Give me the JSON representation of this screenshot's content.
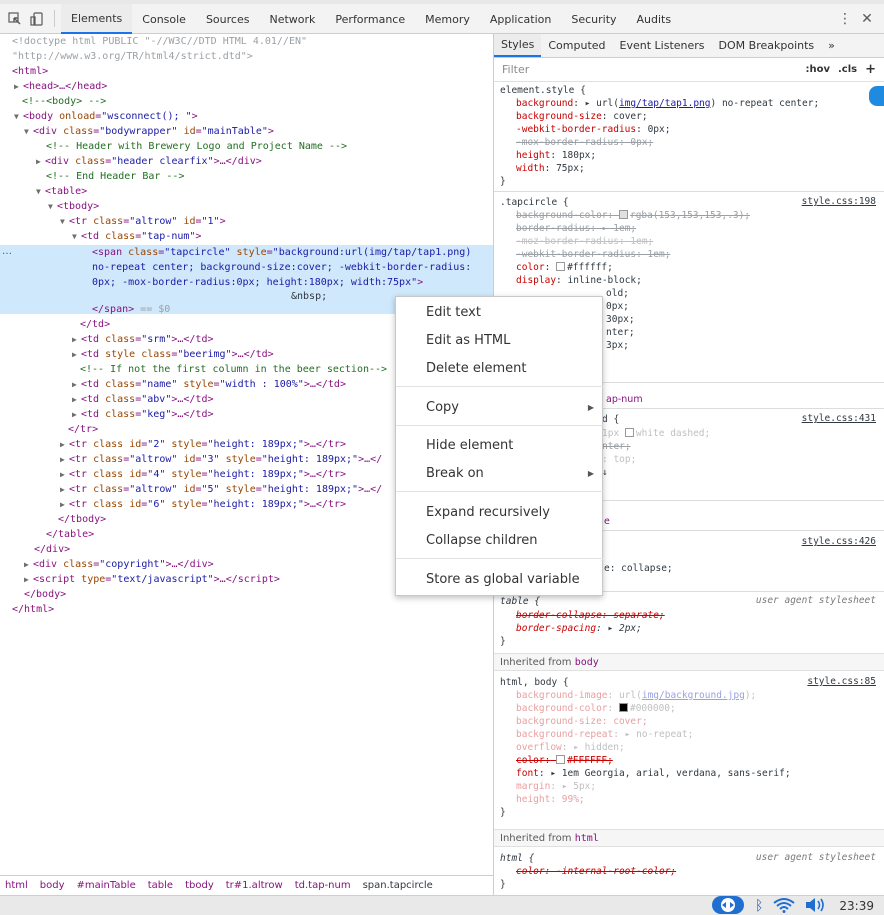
{
  "toolbar": {
    "tabs": [
      "Elements",
      "Console",
      "Sources",
      "Network",
      "Performance",
      "Memory",
      "Application",
      "Security",
      "Audits"
    ],
    "active_tab": "Elements",
    "menu_glyph": "⋮",
    "close_glyph": "✕"
  },
  "dom": {
    "l1a": "<!doctype html PUBLIC \"-//W3C//DTD HTML 4.01//EN\"",
    "l1b": "\"http://www.w3.org/TR/html4/strict.dtd\">",
    "html_open": "<html>",
    "head": "<head>…</head>",
    "body_comment": "<!--<body> -->",
    "body_tag": "<body ",
    "body_attr": "onload",
    "body_val": "\"wsconnect(); \"",
    "div_attr1": "class",
    "div_val1": "\"bodywrapper\"",
    "div_attr2": "id",
    "div_val2": "\"mainTable\"",
    "cmt1": "<!-- Header with Brewery Logo and Project Name -->",
    "header_val": "\"header clearfix\"",
    "cmt2": "<!-- End Header Bar -->",
    "table": "<table>",
    "tbody": "<tbody>",
    "tr1_val1": "\"altrow\"",
    "tr1_val2": "\"1\"",
    "td_val": "\"tap-num\"",
    "span_l1_val1": "\"tapcircle\"",
    "span_l1_val2": "\"background:url(img/tap/tap1.png)",
    "span_l2": "no-repeat center; background-size:cover; -webkit-border-radius:",
    "span_l3": "0px; -mox-border-radius:0px; height:180px; width:75px\"",
    "nbsp": "&nbsp;",
    "span_close": "</span>",
    "eq0": " == $0",
    "td_close": "</td>",
    "srm_val": "\"srm\"",
    "beerimg_val": "\"beerimg\"",
    "cmt3": "<!-- If not the first column in the beer section-->",
    "name_val1": "\"name\"",
    "name_val2": "\"width : 100%\"",
    "abv_val": "\"abv\"",
    "keg_val": "\"keg\"",
    "tr_close": "</tr>",
    "tr2_val1": "\"2\"",
    "tr2_val2": "\"height: 189px;\"",
    "tr3_val1": "\"altrow\"",
    "tr3_val2": "\"3\"",
    "tr3_val3": "\"height: 189px;\"",
    "tr4_val1": "\"4\"",
    "tr4_val2": "\"height: 189px;\"",
    "tr5_val1": "\"altrow\"",
    "tr5_val2": "\"5\"",
    "tr5_val3": "\"height: 189px;\"",
    "tr6_val1": "\"6\"",
    "tr6_val2": "\"height: 189px;\"",
    "tbody_close": "</tbody>",
    "table_close": "</table>",
    "div_close": "</div>",
    "copyright_val": "\"copyright\"",
    "script_val": "\"text/javascript\"",
    "body_close": "</body>",
    "html_close": "</html>",
    "ellipsis": "…"
  },
  "breadcrumb": [
    "html",
    "body",
    "#mainTable",
    "table",
    "tbody",
    "tr#1.altrow",
    "td.tap-num",
    "span.tapcircle"
  ],
  "styles": {
    "tabs": [
      "Styles",
      "Computed",
      "Event Listeners",
      "DOM Breakpoints",
      "»"
    ],
    "active_tab": "Styles",
    "filter_placeholder": "Filter",
    "hov": ":hov",
    "cls": ".cls",
    "plus": "+",
    "element_style": {
      "selector": "element.style {",
      "bg_name": "background",
      "bg_val_pre": "url(",
      "bg_link": "img/tap/tap1.png",
      "bg_val_post": ") no-repeat center;",
      "bgs_name": "background-size",
      "bgs_val": "cover;",
      "wbr_name": "-webkit-border-radius",
      "wbr_val": "0px;",
      "mbr": "-mox-border-radius: 0px;",
      "h_name": "height",
      "h_val": "180px;",
      "w_name": "width",
      "w_val": "75px;",
      "close": "}"
    },
    "tapcircle": {
      "selector": ".tapcircle {",
      "source": "style.css:198",
      "bgc": "background-color:",
      "bgc_val": "rgba(153,153,153,.3);",
      "br": "border-radius:",
      "br_val": "1em;",
      "mozbr": "-moz-border-radius: 1em;",
      "wkbr": "-webkit-border-radius: 1em;",
      "color_name": "color",
      "color_val": "#ffffff;",
      "display_name": "display",
      "display_val": "inline-block;",
      "p1": "old;",
      "p2": "0px;",
      "p3": "30px;",
      "p4": "nter;",
      "p5": "3px;"
    },
    "tapnum": {
      "selector": "ap-num"
    },
    "td_rule": {
      "selector": "d {",
      "source": "style.css:431",
      "l1_pre": "1px ",
      "l1_val": "white dashed;",
      "l2": "nter;",
      "l3": ": top;",
      "l4": "↓"
    },
    "e_rule": {
      "frag": "e"
    },
    "collapse_rule": {
      "source": "style.css:426",
      "val": "e: collapse;"
    },
    "table_ua": {
      "selector": "table {",
      "source": "user agent stylesheet",
      "bc": "border-collapse: separate;",
      "bs_name": "border-spacing",
      "bs_val": "2px;",
      "close": "}"
    },
    "inherited_body": {
      "label": "Inherited from ",
      "tag": "body"
    },
    "html_body": {
      "selector": "html, body {",
      "source": "style.css:85",
      "bgi_name": "background-image",
      "bgi_pre": "url(",
      "bgi_link": "img/background.jpg",
      "bgi_post": ");",
      "bgc_name": "background-color",
      "bgc_val": "#000000;",
      "bgs": "background-size: cover;",
      "bgr_name": "background-repeat",
      "bgr_val": "no-repeat;",
      "of_name": "overflow",
      "of_val": "hidden;",
      "color": "color:",
      "color_val": "#FFFFFF;",
      "font_name": "font",
      "font_val": "1em Georgia, arial, verdana, sans-serif;",
      "margin_name": "margin",
      "margin_val": "5px;",
      "height": "height: 99%;",
      "close": "}"
    },
    "inherited_html": {
      "label": "Inherited from ",
      "tag": "html"
    },
    "html_ua": {
      "selector": "html {",
      "source": "user agent stylesheet",
      "color": "color: -internal-root-color;",
      "close": "}"
    }
  },
  "context_menu": {
    "items": [
      "Edit text",
      "Edit as HTML",
      "Delete element",
      "Copy",
      "Hide element",
      "Break on",
      "Expand recursively",
      "Collapse children",
      "Store as global variable"
    ]
  },
  "taskbar": {
    "clock": "23:39"
  },
  "colors": {
    "accent": "#1a73e8",
    "selection": "#cfe8fc",
    "tag": "#881280",
    "attr": "#994500",
    "value": "#1a1aa6",
    "comment": "#236e25",
    "property": "#c80000"
  }
}
